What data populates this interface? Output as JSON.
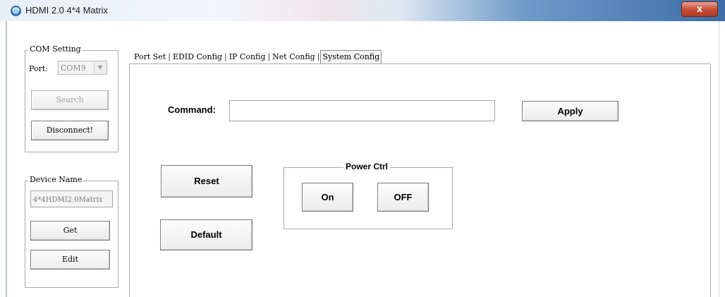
{
  "window": {
    "title": "HDMI 2.0 4*4 Matrix",
    "close_glyph": "x",
    "icon": "app-logo-icon"
  },
  "com_setting": {
    "legend": "COM Setting",
    "port_label": "Port:",
    "port_value": "COM9",
    "search_label": "Search",
    "disconnect_label": "Disconnect!"
  },
  "device_name": {
    "legend": "Device Name",
    "value": "4*4HDMI2.0Matrix",
    "get_label": "Get",
    "edit_label": "Edit"
  },
  "tabs": [
    {
      "label": "Port Set"
    },
    {
      "label": "EDID Config"
    },
    {
      "label": "IP Config"
    },
    {
      "label": "Net Config"
    },
    {
      "label": "System Config"
    }
  ],
  "tab_separator": "|",
  "active_tab": "System Config",
  "system_config": {
    "command_label": "Command:",
    "command_value": "",
    "apply_label": "Apply",
    "reset_label": "Reset",
    "default_label": "Default",
    "power": {
      "legend": "Power Ctrl",
      "on_label": "On",
      "off_label": "OFF"
    }
  }
}
